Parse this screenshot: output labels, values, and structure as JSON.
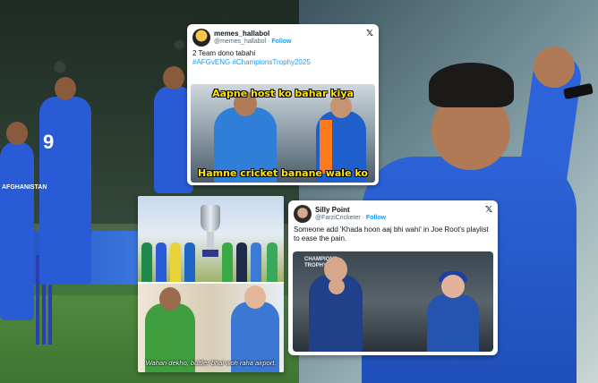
{
  "tweet1": {
    "display_name": "memes_hallabol",
    "handle": "@memes_hallabol",
    "follow_label": "Follow",
    "separator": "·",
    "x_logo": "𝕏",
    "text": "2 Team dono tabahi",
    "hashtags": "#AFGvENG #ChampionsTrophy2025",
    "meme_top_caption": "Aapne host ko bahar kiya",
    "meme_bottom_caption": "Hamne cricket banane wale ko"
  },
  "tweet2": {
    "subtitle": "Wahan dekho, buttler bhai woh raha airport."
  },
  "tweet3": {
    "display_name": "Silly Point",
    "handle": "@FarziCricketer",
    "follow_label": "Follow",
    "separator": "·",
    "x_logo": "𝕏",
    "text": "Someone add 'Khada hoon aaj bhi wahi' in Joe Root's playlist to ease the pain.",
    "logo_text_line1": "CHAMPIONS",
    "logo_text_line2": "TROPHY"
  },
  "photo": {
    "jersey_number": "9",
    "jersey_team": "AFGHANISTAN"
  },
  "colors": {
    "twitter_blue": "#1d9bf0",
    "meme_yellow": "#ffe600",
    "afg_blue": "#2a5bd7"
  }
}
